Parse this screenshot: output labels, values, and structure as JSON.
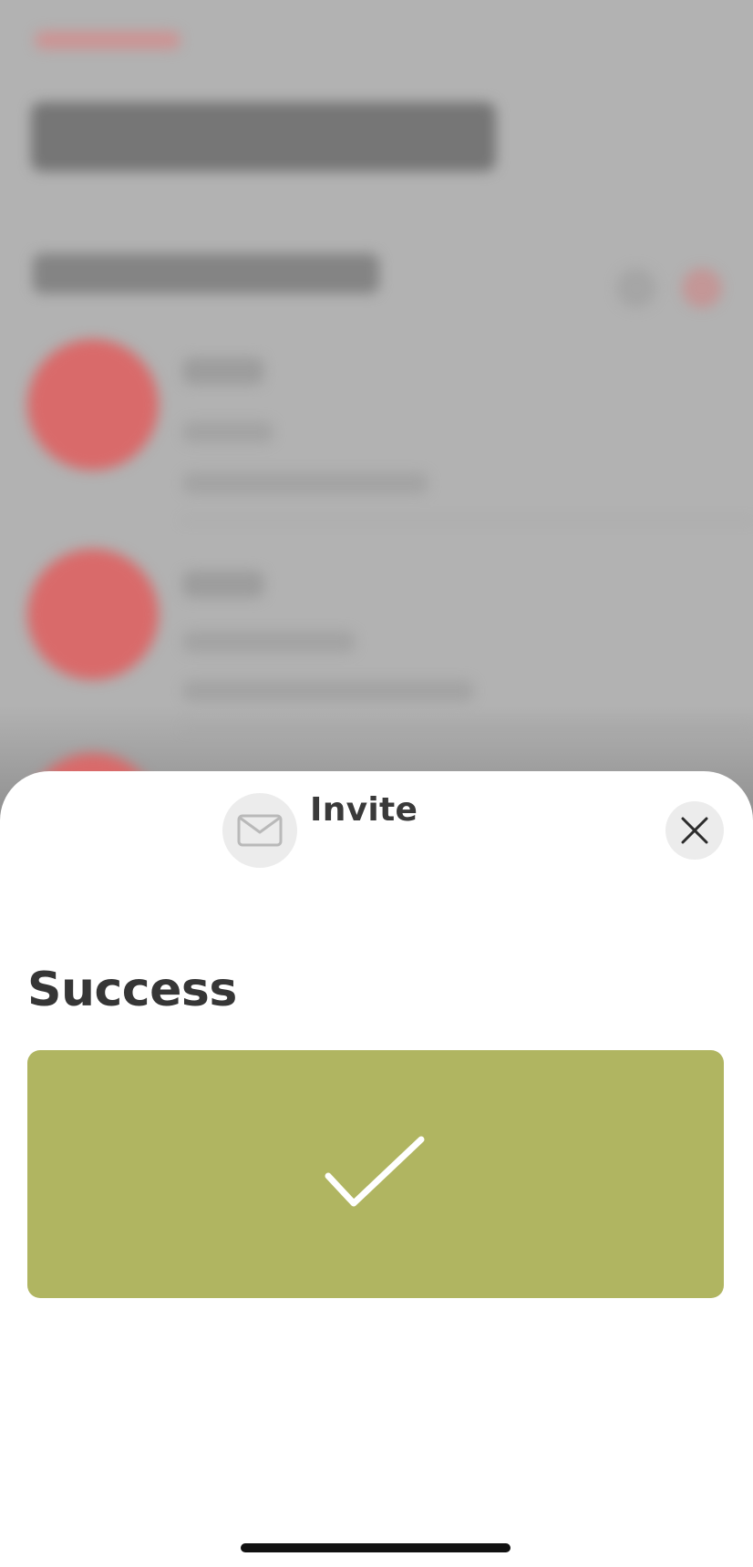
{
  "sheet": {
    "title": "Invite",
    "header_icon": "envelope-icon",
    "close_icon": "close-icon"
  },
  "main": {
    "heading": "Success",
    "status_icon": "checkmark-icon",
    "panel_color": "#b0b561"
  },
  "colors": {
    "accent": "#b0b561",
    "background_accent": "#d96a6a"
  }
}
